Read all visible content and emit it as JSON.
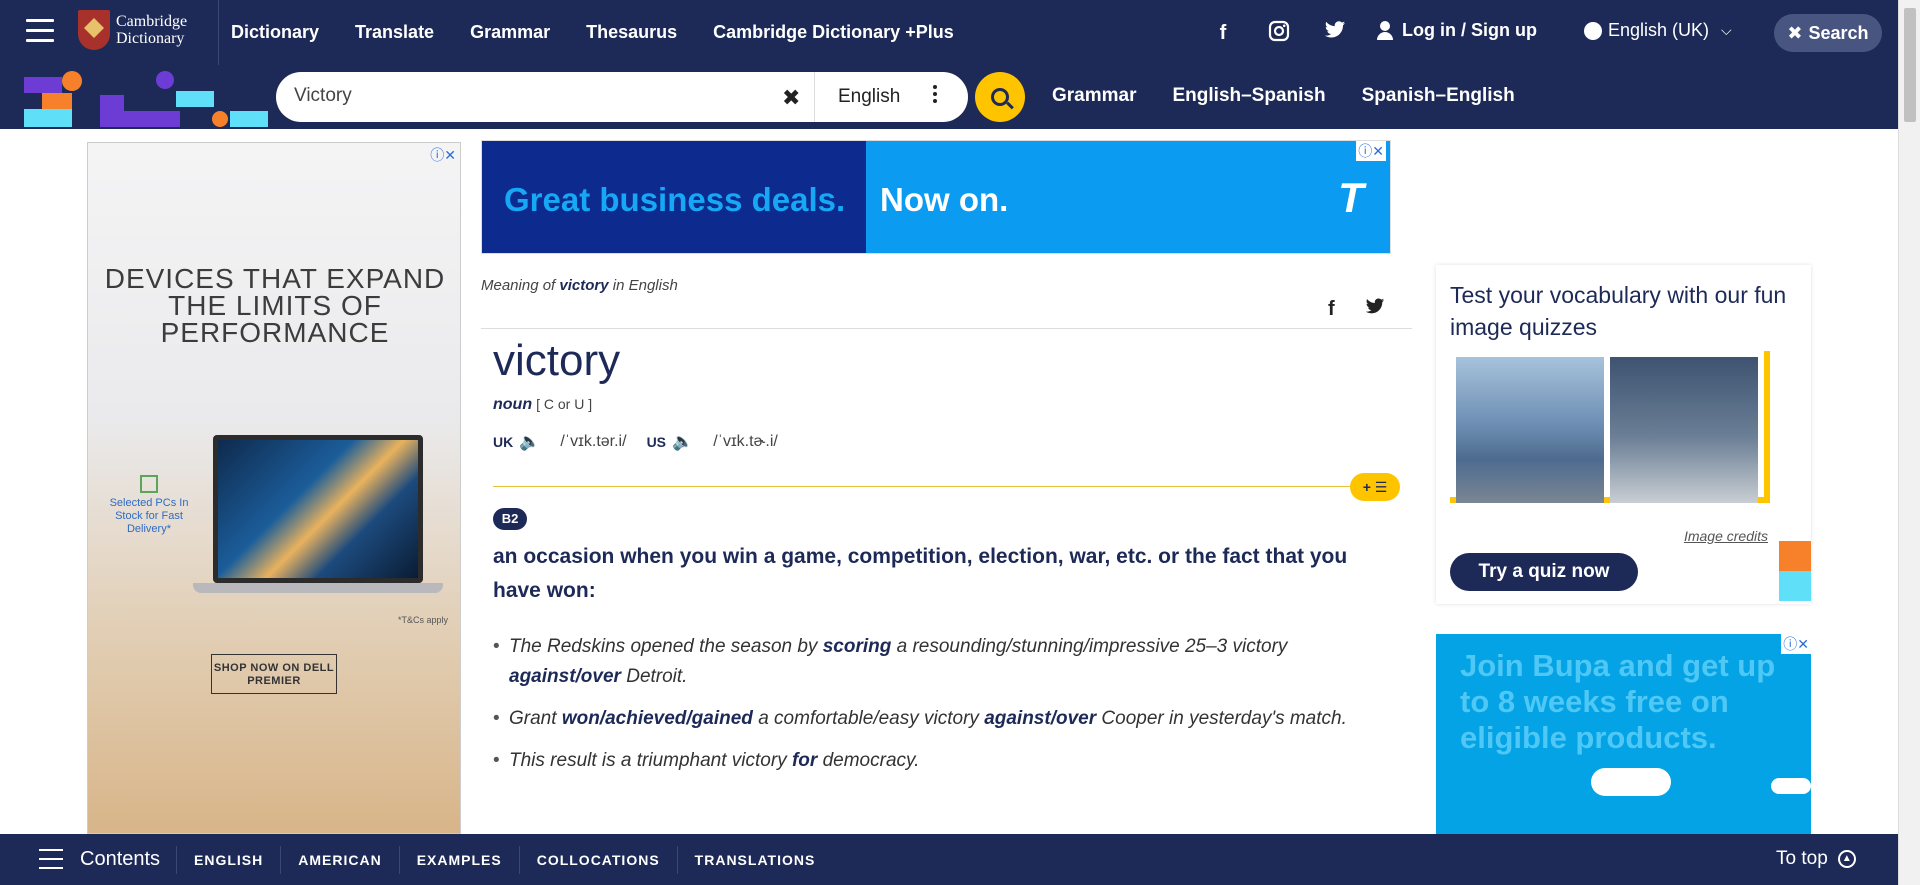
{
  "header": {
    "logo_text_1": "Cambridge",
    "logo_text_2": "Dictionary",
    "nav": [
      "Dictionary",
      "Translate",
      "Grammar",
      "Thesaurus",
      "Cambridge Dictionary +Plus"
    ],
    "social": [
      "facebook-icon",
      "instagram-icon",
      "twitter-icon"
    ],
    "login_label": "Log in / Sign up",
    "language_label": "English (UK)",
    "search_toggle_label": "Search"
  },
  "search": {
    "value": "Victory",
    "language": "English",
    "quick_links": [
      "Grammar",
      "English–Spanish",
      "Spanish–English"
    ]
  },
  "left_ad": {
    "headline": "DEVICES THAT EXPAND THE LIMITS OF PERFORMANCE",
    "stock_note": "Selected PCs In Stock for Fast Delivery*",
    "tcs": "*T&Cs apply",
    "cta": "SHOP NOW ON DELL PREMIER"
  },
  "banner_ad": {
    "text_1": "Great business deals.",
    "text_2": "Now on.",
    "logo_letter": "T"
  },
  "entry": {
    "meaning_prefix": "Meaning of ",
    "meaning_word": "victory",
    "meaning_suffix": " in English",
    "headword": "victory",
    "pos": "noun",
    "grammar": "[ C or U ]",
    "uk_label": "UK",
    "uk_ipa": "/ˈvɪk.tər.i/",
    "us_label": "US",
    "us_ipa": "/ˈvɪk.tɚ.i/",
    "level": "B2",
    "definition": "an occasion when you win a game, competition, election, war, etc. or the fact that you have won:",
    "examples": [
      [
        {
          "t": "The Redskins opened the season by ",
          "b": false
        },
        {
          "t": "scoring",
          "b": true
        },
        {
          "t": " a resounding/stunning/impressive 25–3 victory ",
          "b": false
        },
        {
          "t": "against/over",
          "b": true
        },
        {
          "t": " Detroit.",
          "b": false
        }
      ],
      [
        {
          "t": "Grant ",
          "b": false
        },
        {
          "t": "won/achieved/gained",
          "b": true
        },
        {
          "t": " a comfortable/easy victory ",
          "b": false
        },
        {
          "t": "against/over",
          "b": true
        },
        {
          "t": " Cooper in yesterday's match.",
          "b": false
        }
      ],
      [
        {
          "t": "This result is a triumphant victory ",
          "b": false
        },
        {
          "t": "for",
          "b": true
        },
        {
          "t": " democracy.",
          "b": false
        }
      ]
    ]
  },
  "quiz": {
    "title": "Test your vocabulary with our fun image quizzes",
    "credits": "Image credits",
    "cta": "Try a quiz now"
  },
  "right_ad": {
    "text": "Join Bupa and get up to 8 weeks free on eligible products."
  },
  "bottom_bar": {
    "contents_label": "Contents",
    "links": [
      "ENGLISH",
      "AMERICAN",
      "EXAMPLES",
      "COLLOCATIONS",
      "TRANSLATIONS"
    ],
    "to_top_label": "To top"
  },
  "colors": {
    "brand_navy": "#1d2a57",
    "accent_yellow": "#fec400"
  }
}
